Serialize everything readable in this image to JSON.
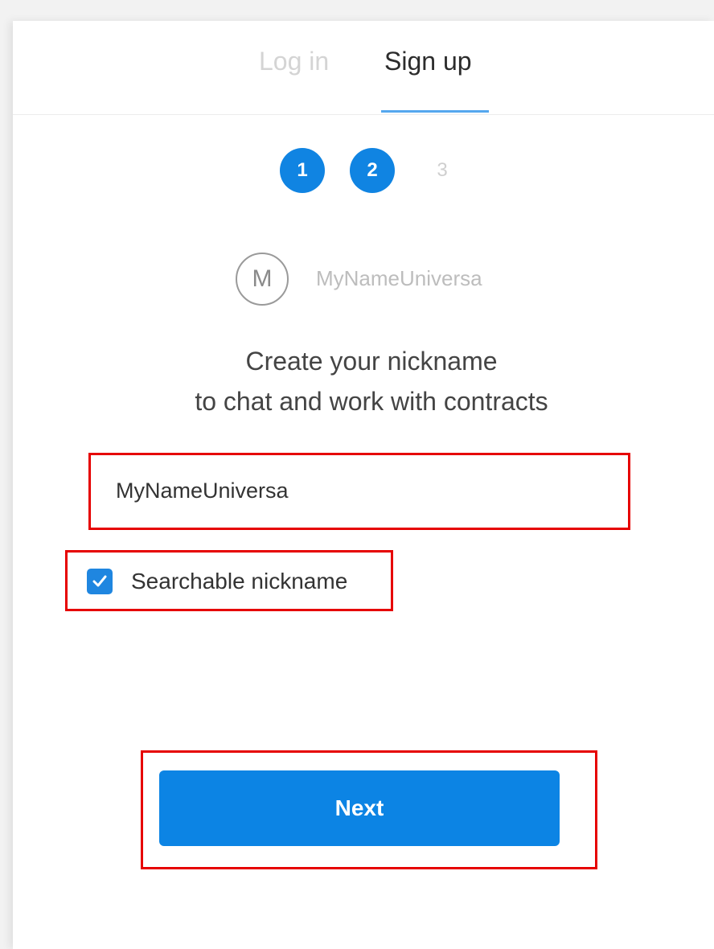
{
  "tabs": {
    "login_label": "Log in",
    "signup_label": "Sign up",
    "active": "Sign up"
  },
  "steps": [
    {
      "label": "1",
      "state": "completed"
    },
    {
      "label": "2",
      "state": "active"
    },
    {
      "label": "3",
      "state": "upcoming"
    }
  ],
  "profile": {
    "avatar_initial": "M",
    "name": "MyNameUniversa"
  },
  "heading": {
    "line1": "Create your nickname",
    "line2": "to chat and work with contracts"
  },
  "nickname_input": {
    "value": "MyNameUniversa"
  },
  "searchable": {
    "label": "Searchable nickname",
    "checked": true
  },
  "next_button": {
    "label": "Next"
  },
  "colors": {
    "accent": "#0c84e4",
    "highlight_frame": "#e60000"
  }
}
